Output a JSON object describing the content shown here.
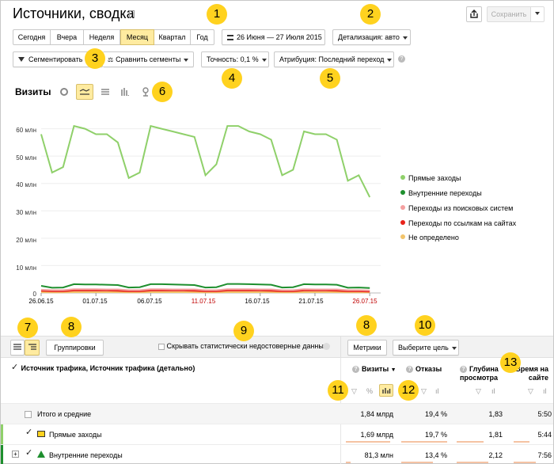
{
  "header": {
    "title": "Источники, сводка",
    "save_label": "Сохранить"
  },
  "periods": [
    "Сегодня",
    "Вчера",
    "Неделя",
    "Месяц",
    "Квартал",
    "Год"
  ],
  "date_range": "26 Июня — 27 Июля 2015",
  "detail": "Детализация: авто",
  "segment_label": "Сегментировать",
  "compare_label": "Сравнить сегменты",
  "accuracy_label": "Точность: 0,1 %",
  "attribution_label": "Атрибуция: Последний переход",
  "chart_title": "Визиты",
  "markers": [
    "1",
    "2",
    "3",
    "4",
    "5",
    "6",
    "7",
    "8",
    "9",
    "8",
    "10",
    "11",
    "12",
    "13"
  ],
  "chart_data": {
    "type": "line",
    "x": [
      "26.06.15",
      "27.06.15",
      "28.06.15",
      "29.06.15",
      "30.06.15",
      "01.07.15",
      "02.07.15",
      "03.07.15",
      "04.07.15",
      "05.07.15",
      "06.07.15",
      "07.07.15",
      "08.07.15",
      "09.07.15",
      "10.07.15",
      "11.07.15",
      "12.07.15",
      "13.07.15",
      "14.07.15",
      "15.07.15",
      "16.07.15",
      "17.07.15",
      "18.07.15",
      "19.07.15",
      "20.07.15",
      "21.07.15",
      "22.07.15",
      "23.07.15",
      "24.07.15",
      "25.07.15",
      "26.07.15",
      "27.07.15"
    ],
    "xticks": [
      "26.06.15",
      "01.07.15",
      "06.07.15",
      "11.07.15",
      "16.07.15",
      "21.07.15",
      "26.07.15"
    ],
    "xtick_colors": [
      "#000",
      "#000",
      "#000",
      "#c00000",
      "#000",
      "#000",
      "#c00000"
    ],
    "yticks": [
      "60 млн",
      "50 млн",
      "40 млн",
      "30 млн",
      "20 млн",
      "10 млн",
      "0"
    ],
    "ylim": [
      0,
      70
    ],
    "series": [
      {
        "name": "Прямые заходы",
        "color": "#8fd06a",
        "values": [
          58,
          44,
          46,
          61,
          60,
          58,
          58,
          55,
          42,
          44,
          61,
          60,
          59,
          58,
          57,
          43,
          47,
          61,
          61,
          59,
          58,
          56,
          43,
          45,
          59,
          58,
          58,
          56,
          41,
          43,
          35
        ]
      },
      {
        "name": "Внутренние переходы",
        "color": "#1e8f2e",
        "values": [
          2.6,
          1.9,
          2.0,
          3.2,
          3.1,
          3.1,
          3.0,
          2.9,
          2.0,
          2.1,
          3.2,
          3.2,
          3.1,
          3.0,
          2.9,
          2.0,
          2.1,
          3.3,
          3.3,
          3.2,
          3.1,
          3.0,
          2.0,
          2.1,
          3.2,
          3.1,
          3.1,
          3.0,
          1.9,
          2.0,
          1.8
        ]
      },
      {
        "name": "Переходы из поисковых систем",
        "color": "#f4a0a0",
        "values": [
          1.2,
          1.0,
          1.0,
          1.4,
          1.4,
          1.4,
          1.3,
          1.3,
          1.0,
          1.0,
          1.4,
          1.4,
          1.3,
          1.3,
          1.3,
          1.0,
          1.0,
          1.4,
          1.4,
          1.4,
          1.3,
          1.3,
          1.0,
          1.0,
          1.4,
          1.3,
          1.3,
          1.3,
          1.0,
          1.0,
          0.9
        ]
      },
      {
        "name": "Переходы по ссылкам на сайтах",
        "color": "#e8221a",
        "values": [
          0.8,
          0.6,
          0.6,
          0.9,
          0.9,
          0.9,
          0.9,
          0.8,
          0.6,
          0.6,
          0.9,
          0.9,
          0.9,
          0.9,
          0.8,
          0.6,
          0.6,
          0.9,
          0.9,
          0.9,
          0.9,
          0.8,
          0.6,
          0.6,
          0.9,
          0.9,
          0.9,
          0.8,
          0.6,
          0.6,
          0.5
        ]
      },
      {
        "name": "Не определено",
        "color": "#f2c46b",
        "values": [
          0.3,
          0.2,
          0.2,
          0.3,
          0.3,
          0.3,
          0.3,
          0.3,
          0.2,
          0.2,
          0.3,
          0.3,
          0.3,
          0.3,
          0.3,
          0.2,
          0.2,
          0.3,
          0.3,
          0.3,
          0.3,
          0.3,
          0.2,
          0.2,
          0.3,
          0.3,
          0.3,
          0.3,
          0.2,
          0.2,
          0.2
        ]
      }
    ]
  },
  "toolbar": {
    "group_label": "Группировки",
    "hide_label": "Скрывать статистически недостоверные данные",
    "metrics_label": "Метрики",
    "goal_label": "Выберите цель"
  },
  "table": {
    "dimension_header": "Источник трафика, Источник трафика (детально)",
    "columns": [
      "Визиты",
      "Отказы",
      "Глубина просмотра",
      "Время на сайте"
    ],
    "rows": [
      {
        "label": "Итого и средние",
        "values": [
          "1,84 млрд",
          "19,4 %",
          "1,83",
          "5:50"
        ]
      },
      {
        "label": "Прямые заходы",
        "values": [
          "1,69 млрд",
          "19,7 %",
          "1,81",
          "5:44"
        ]
      },
      {
        "label": "Внутренние переходы",
        "values": [
          "81,3 млн",
          "13,4 %",
          "2,12",
          "7:56"
        ]
      }
    ]
  }
}
